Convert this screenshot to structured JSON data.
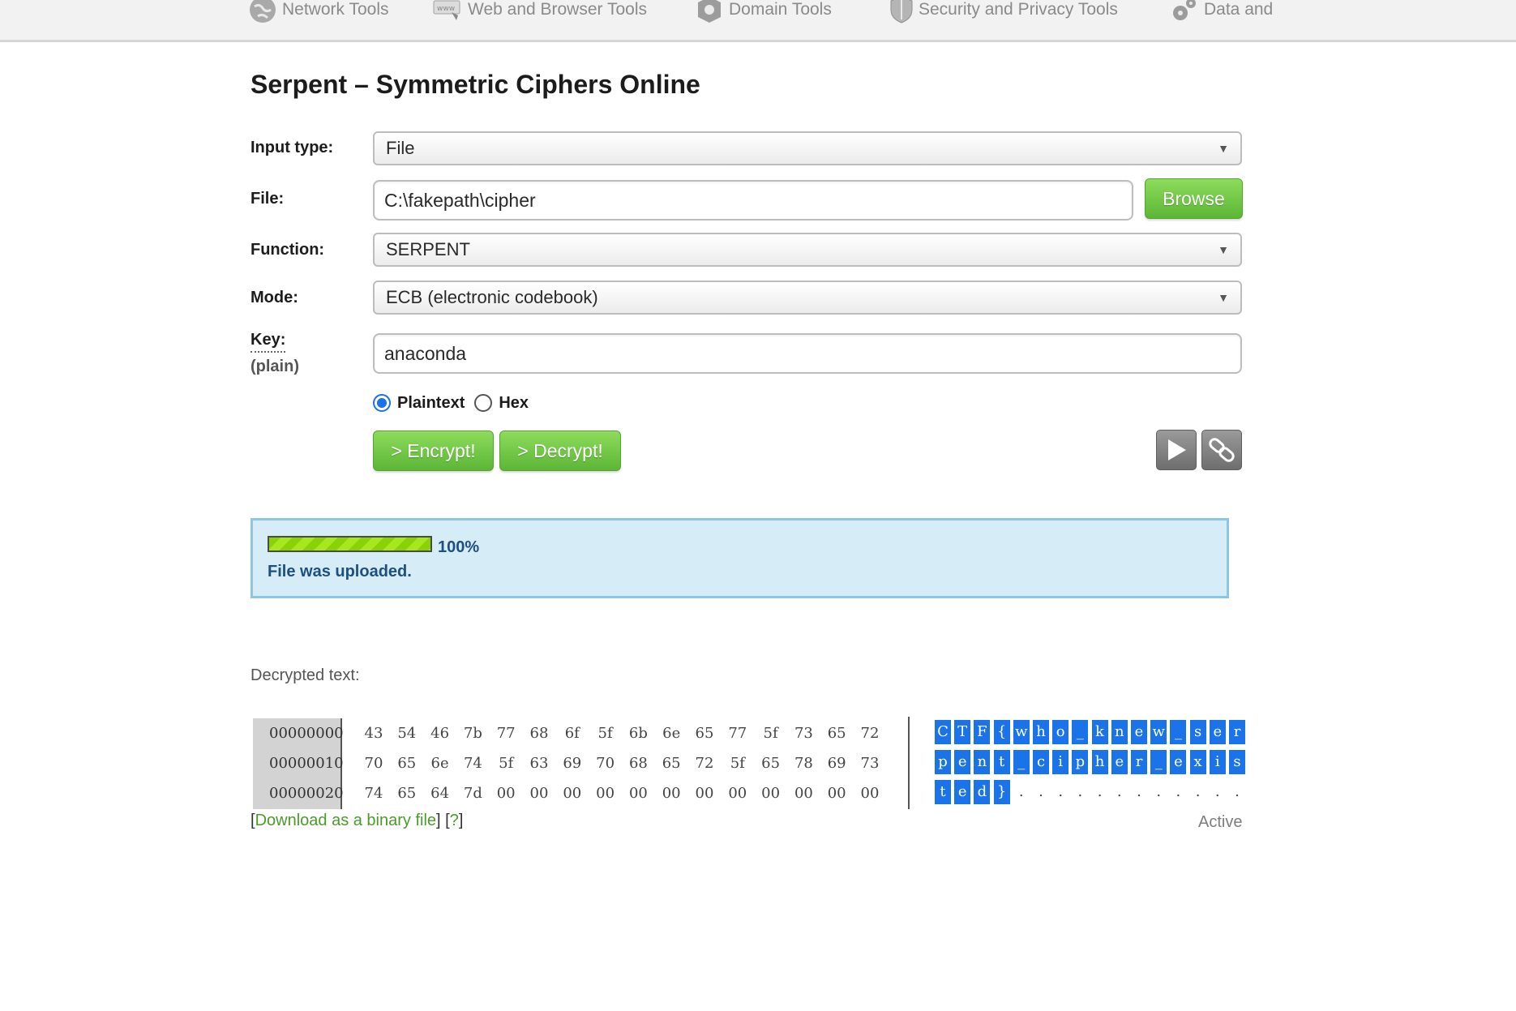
{
  "nav": {
    "items": [
      {
        "label": "Network Tools",
        "icon": "globe-icon"
      },
      {
        "label": "Web and Browser Tools",
        "icon": "www-icon"
      },
      {
        "label": "Domain Tools",
        "icon": "domain-icon"
      },
      {
        "label": "Security and Privacy Tools",
        "icon": "shield-icon"
      },
      {
        "label": "Data and",
        "icon": "gears-icon"
      }
    ]
  },
  "page": {
    "title": "Serpent – Symmetric Ciphers Online"
  },
  "form": {
    "input_type": {
      "label": "Input type:",
      "value": "File"
    },
    "file": {
      "label": "File:",
      "value": "C:\\fakepath\\cipher",
      "browse_label": "Browse"
    },
    "function": {
      "label": "Function:",
      "value": "SERPENT"
    },
    "mode": {
      "label": "Mode:",
      "value": "ECB (electronic codebook)"
    },
    "key": {
      "label": "Key:",
      "sublabel": "(plain)",
      "value": "anaconda"
    },
    "key_format": {
      "options": [
        {
          "label": "Plaintext",
          "selected": true
        },
        {
          "label": "Hex",
          "selected": false
        }
      ]
    },
    "encrypt_label": "> Encrypt!",
    "decrypt_label": "> Decrypt!",
    "play_icon": "play-icon",
    "link_icon": "link-icon"
  },
  "status": {
    "progress": 1.0,
    "progress_text": "100%",
    "message": "File was uploaded."
  },
  "output": {
    "label": "Decrypted text:",
    "hex_rows": [
      {
        "offset": "00000000",
        "bytes": [
          "43",
          "54",
          "46",
          "7b",
          "77",
          "68",
          "6f",
          "5f",
          "6b",
          "6e",
          "65",
          "77",
          "5f",
          "73",
          "65",
          "72"
        ],
        "ascii": [
          "C",
          "T",
          "F",
          "{",
          "w",
          "h",
          "o",
          "_",
          "k",
          "n",
          "e",
          "w",
          "_",
          "s",
          "e",
          "r"
        ]
      },
      {
        "offset": "00000010",
        "bytes": [
          "70",
          "65",
          "6e",
          "74",
          "5f",
          "63",
          "69",
          "70",
          "68",
          "65",
          "72",
          "5f",
          "65",
          "78",
          "69",
          "73"
        ],
        "ascii": [
          "p",
          "e",
          "n",
          "t",
          "_",
          "c",
          "i",
          "p",
          "h",
          "e",
          "r",
          "_",
          "e",
          "x",
          "i",
          "s"
        ]
      },
      {
        "offset": "00000020",
        "bytes": [
          "74",
          "65",
          "64",
          "7d",
          "00",
          "00",
          "00",
          "00",
          "00",
          "00",
          "00",
          "00",
          "00",
          "00",
          "00",
          "00"
        ],
        "ascii": [
          "t",
          "e",
          "d",
          "}",
          ".",
          ".",
          ".",
          ".",
          ".",
          ".",
          ".",
          ".",
          ".",
          ".",
          ".",
          "."
        ]
      }
    ],
    "download_prefix": "[",
    "download_link": "Download as a binary file",
    "download_middle": "] [",
    "help_link": "?",
    "download_suffix": "]",
    "active_label": "Active"
  },
  "colors": {
    "button_green": "#5cb536",
    "link_green": "#4a9c2a",
    "status_bg": "#d6ecf7",
    "status_text": "#1d4f80",
    "ascii_highlight": "#1a73e8"
  }
}
